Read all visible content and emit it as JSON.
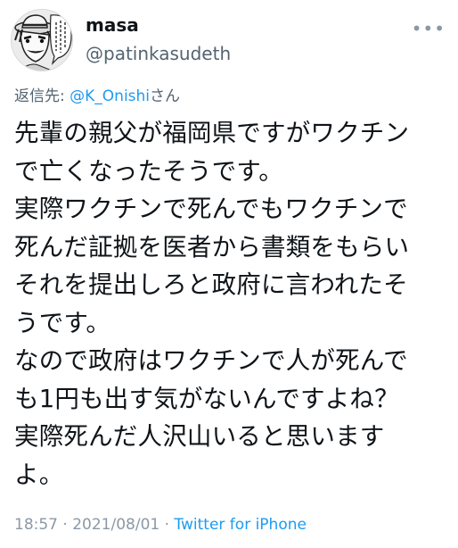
{
  "tweet": {
    "user": {
      "display_name": "masa",
      "handle": "@patinkasudeth"
    },
    "reply": {
      "prefix": "返信先: ",
      "mention": "@K_Onishi",
      "suffix": "さん"
    },
    "lines": [
      "先輩の親父が福岡県ですがワクチン",
      "で亡くなったそうです。",
      "実際ワクチンで死んでもワクチンで",
      "死んだ証拠を医者から書類をもらい",
      "それを提出しろと政府に言われたそ",
      "うです。",
      "なので政府はワクチンで人が死んで",
      "も1円も出す気がないんですよね？",
      "実際死んだ人沢山いると思います",
      "よ。"
    ],
    "time": "18:57",
    "sep1": " · ",
    "date": "2021/08/01",
    "sep2": " · ",
    "source": "Twitter for iPhone",
    "more_glyph": "•••"
  }
}
